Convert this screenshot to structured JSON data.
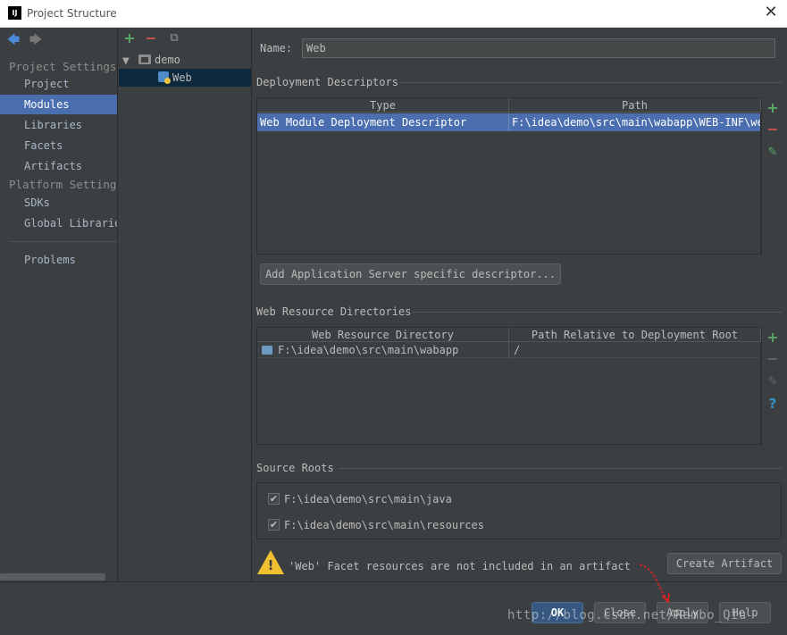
{
  "window": {
    "title": "Project Structure",
    "app_icon": "IJ",
    "close_glyph": "✕"
  },
  "nav": {
    "back_glyph": "🡄",
    "forward_glyph": "🡆",
    "section_project": "Project Settings",
    "project_items": [
      "Project",
      "Modules",
      "Libraries",
      "Facets",
      "Artifacts"
    ],
    "section_platform": "Platform Settings",
    "platform_items": [
      "SDKs",
      "Global Libraries"
    ],
    "problems": "Problems",
    "selected": "Modules"
  },
  "tree": {
    "add_glyph": "+",
    "remove_glyph": "−",
    "copy_glyph": "⧉",
    "collapse_glyph": "▼",
    "root": "demo",
    "child": "Web"
  },
  "form": {
    "name_label": "Name:",
    "name_value": "Web"
  },
  "deployment": {
    "title": "Deployment Descriptors",
    "columns": [
      "Type",
      "Path"
    ],
    "rows": [
      {
        "type": "Web Module Deployment Descriptor",
        "path": "F:\\idea\\demo\\src\\main\\wabapp\\WEB-INF\\web.xml"
      }
    ],
    "add_glyph": "+",
    "remove_glyph": "−",
    "edit_glyph": "✎",
    "add_server_button": "Add Application Server specific descriptor..."
  },
  "web_resources": {
    "title": "Web Resource Directories",
    "columns": [
      "Web Resource Directory",
      "Path Relative to Deployment Root"
    ],
    "rows": [
      {
        "dir": "F:\\idea\\demo\\src\\main\\wabapp",
        "relative": "/"
      }
    ],
    "add_glyph": "+",
    "remove_glyph": "−",
    "edit_glyph": "✎",
    "help_glyph": "?"
  },
  "source_roots": {
    "title": "Source Roots",
    "check_glyph": "✔",
    "items": [
      {
        "path": "F:\\idea\\demo\\src\\main\\java",
        "checked": true
      },
      {
        "path": "F:\\idea\\demo\\src\\main\\resources",
        "checked": true
      }
    ]
  },
  "warning": {
    "icon_glyph": "!",
    "text": "'Web' Facet resources are not included in an artifact",
    "create_button": "Create Artifact"
  },
  "footer": {
    "ok": "OK",
    "close": "Close",
    "apply": "Apply",
    "help": "Help"
  },
  "watermark": "http://blog.csdn.net/Rambo_Qiu",
  "colors": {
    "background": "#3c3f41",
    "selection": "#4b6eaf",
    "add_green": "#59a869",
    "remove_red": "#c75450",
    "warning_yellow": "#f0c030",
    "annotation_red": "#e02020"
  }
}
